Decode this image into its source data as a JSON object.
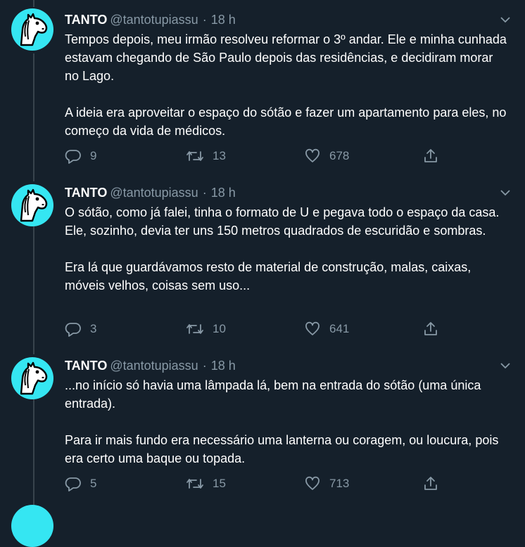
{
  "tweets": [
    {
      "name": "TANTO",
      "handle": "@tantotupiassu",
      "separator": "·",
      "time": "18 h",
      "paragraphs": [
        "Tempos depois, meu irmão resolveu reformar o 3º andar. Ele e minha cunhada estavam chegando de São Paulo depois das residências, e decidiram morar no Lago.",
        "A ideia era aproveitar o espaço do sótão e fazer um apartamento para eles, no começo da vida de médicos."
      ],
      "replies": "9",
      "retweets": "13",
      "likes": "678"
    },
    {
      "name": "TANTO",
      "handle": "@tantotupiassu",
      "separator": "·",
      "time": "18 h",
      "paragraphs": [
        "O sótão, como já falei, tinha o formato de U e pegava todo o espaço da casa. Ele, sozinho, devia ter uns 150 metros quadrados de escuridão e sombras.",
        "Era lá que guardávamos resto de material de construção, malas, caixas, móveis velhos, coisas sem uso..."
      ],
      "replies": "3",
      "retweets": "10",
      "likes": "641"
    },
    {
      "name": "TANTO",
      "handle": "@tantotupiassu",
      "separator": "·",
      "time": "18 h",
      "paragraphs": [
        "...no início só havia uma lâmpada lá, bem na entrada do sótão (uma única entrada).",
        "Para ir mais fundo era necessário uma lanterna ou coragem, ou loucura, pois era certo uma baque ou topada."
      ],
      "replies": "5",
      "retweets": "15",
      "likes": "713"
    }
  ],
  "icons": {
    "reply": "reply-icon",
    "retweet": "retweet-icon",
    "like": "heart-icon",
    "share": "share-icon",
    "caret": "chevron-down-icon",
    "avatar": "horse-avatar"
  },
  "colors": {
    "background": "#15202b",
    "text": "#ffffff",
    "secondary": "#8899a6",
    "avatar_bg": "#35e6f2",
    "thread_line": "#38444d"
  }
}
